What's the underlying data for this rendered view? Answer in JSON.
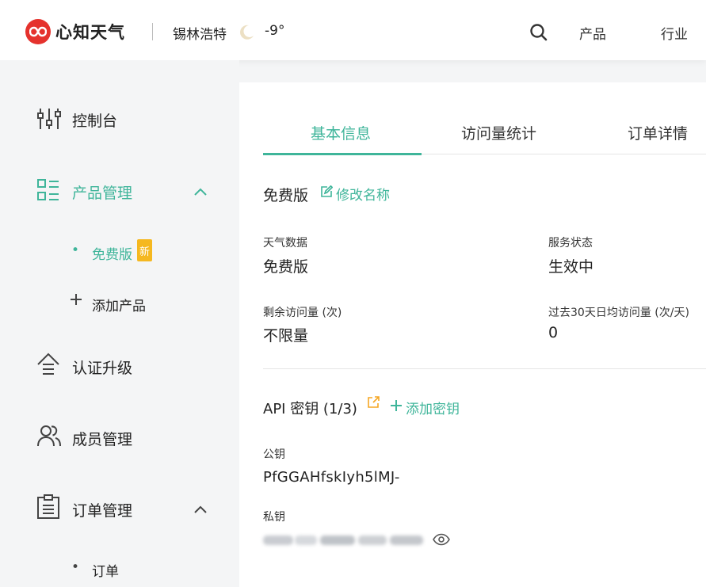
{
  "header": {
    "brand": "心知天气",
    "city": "锡林浩特",
    "temperature": "-9°",
    "weather_icon": "moon-icon",
    "nav": [
      "产品",
      "行业"
    ]
  },
  "sidebar": {
    "items": [
      {
        "label": "控制台",
        "icon": "dashboard-sliders-icon"
      },
      {
        "label": "产品管理",
        "icon": "product-list-icon",
        "expanded": true
      },
      {
        "label": "认证升级",
        "icon": "upgrade-icon"
      },
      {
        "label": "成员管理",
        "icon": "members-icon"
      },
      {
        "label": "订单管理",
        "icon": "clipboard-icon",
        "expanded": true
      }
    ],
    "product_sub": {
      "active_label": "免费版",
      "badge": "新",
      "add_label": "添加产品"
    },
    "order_sub": {
      "label": "订单"
    }
  },
  "tabs": [
    "基本信息",
    "访问量统计",
    "订单详情"
  ],
  "active_tab": 0,
  "plan": {
    "name": "免费版",
    "rename_label": "修改名称"
  },
  "info": {
    "weather_data_label": "天气数据",
    "weather_data_value": "免费版",
    "service_status_label": "服务状态",
    "service_status_value": "生效中",
    "remaining_label": "剩余访问量 (次)",
    "remaining_value": "不限量",
    "avg_label": "过去30天日均访问量 (次/天)",
    "avg_value": "0"
  },
  "api": {
    "title": "API 密钥 (1/3)",
    "add_label": "添加密钥",
    "public_key_label": "公钥",
    "public_key_value": "PfGGAHfskIyh5lMJ-",
    "private_key_label": "私钥"
  },
  "colors": {
    "accent": "#3fb59a",
    "brand_red": "#e5322d",
    "badge": "#f5b820"
  }
}
